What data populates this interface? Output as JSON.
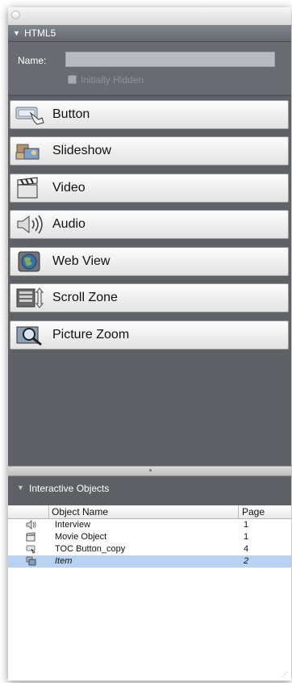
{
  "panel": {
    "section_title": "HTML5",
    "name_label": "Name:",
    "name_value": "",
    "initially_hidden_label": "Initially Hidden"
  },
  "objects": [
    {
      "label": "Button",
      "icon": "button-icon"
    },
    {
      "label": "Slideshow",
      "icon": "slideshow-icon"
    },
    {
      "label": "Video",
      "icon": "video-icon"
    },
    {
      "label": "Audio",
      "icon": "audio-icon"
    },
    {
      "label": "Web View",
      "icon": "web-view-icon"
    },
    {
      "label": "Scroll Zone",
      "icon": "scroll-zone-icon"
    },
    {
      "label": "Picture Zoom",
      "icon": "picture-zoom-icon"
    }
  ],
  "interactive_objects": {
    "title": "Interactive Objects",
    "columns": {
      "name": "Object Name",
      "page": "Page"
    },
    "rows": [
      {
        "name": "Interview",
        "page": "1",
        "icon": "audio-icon"
      },
      {
        "name": "Movie Object",
        "page": "1",
        "icon": "video-icon"
      },
      {
        "name": "TOC Button_copy",
        "page": "4",
        "icon": "button-icon"
      },
      {
        "name": "Item",
        "page": "2",
        "icon": "slideshow-icon",
        "selected": true
      }
    ]
  },
  "colors": {
    "panel_bg": "#5e6267",
    "selection": "#b7d3f1"
  }
}
